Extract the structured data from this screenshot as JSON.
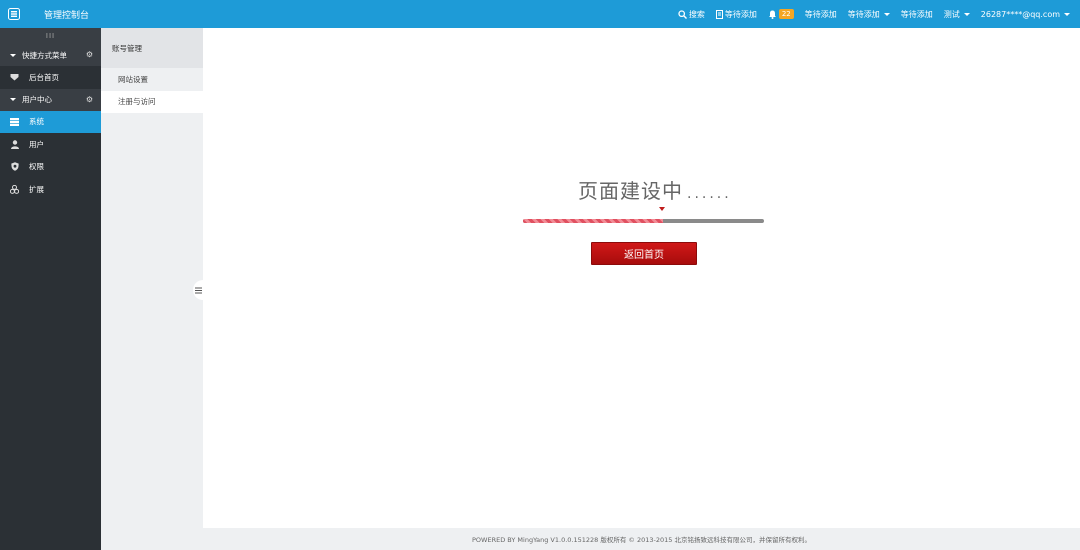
{
  "topbar": {
    "title": "管理控制台",
    "nav": [
      {
        "label": "搜索",
        "icon": "search-icon"
      },
      {
        "label": "等待添加",
        "icon": "file-icon"
      },
      {
        "label": "22",
        "icon": "bell-icon"
      },
      {
        "label": "等待添加"
      },
      {
        "label": "等待添加",
        "dropdown": true
      },
      {
        "label": "等待添加"
      },
      {
        "label": "测试",
        "dropdown": true
      },
      {
        "label": "26287****@qq.com",
        "dropdown": true
      }
    ],
    "badge_color": "#f5a623",
    "bar_color": "#1e9bd7"
  },
  "sidebar": {
    "toggle_label": "III",
    "groups": [
      {
        "label": "快捷方式菜单",
        "items": [
          {
            "label": "后台首页",
            "icon": "dashboard-icon"
          }
        ]
      },
      {
        "label": "用户中心",
        "items": [
          {
            "label": "系统",
            "icon": "server-icon",
            "active": true
          },
          {
            "label": "用户",
            "icon": "user-icon"
          },
          {
            "label": "权限",
            "icon": "shield-icon"
          },
          {
            "label": "扩展",
            "icon": "extension-icon"
          }
        ]
      }
    ]
  },
  "subsidebar": {
    "header": "账号管理",
    "items": [
      {
        "label": "网站设置",
        "active": false
      },
      {
        "label": "注册与访问",
        "active": true
      }
    ]
  },
  "main": {
    "title": "页面建设中",
    "dots": "......",
    "progress": 0.58,
    "button_label": "返回首页"
  },
  "footer": {
    "text": "POWERED BY MingYang V1.0.0.151228 版权所有 © 2013-2015 北京铭扬致远科技有限公司，并保留所有权利。"
  }
}
